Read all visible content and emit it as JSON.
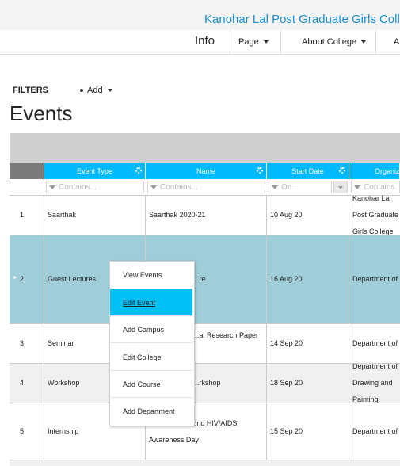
{
  "header": {
    "college_name": "Kanohar Lal Post Graduate Girls College"
  },
  "nav": {
    "info": "Info",
    "items": [
      {
        "label": "Page"
      },
      {
        "label": "About College"
      },
      {
        "label": "A"
      }
    ]
  },
  "toolbar": {
    "filters_label": "FILTERS",
    "add_label": "Add"
  },
  "page": {
    "title": "Events"
  },
  "grid": {
    "columns": [
      {
        "label": ""
      },
      {
        "label": "Event Type"
      },
      {
        "label": "Name"
      },
      {
        "label": "Start Date"
      },
      {
        "label": "Organizer"
      }
    ],
    "filter_placeholders": [
      "Contains...",
      "Contains...",
      "On...",
      "Contains"
    ],
    "rows": [
      {
        "num": "1",
        "type": "Saarthak",
        "name": "Saarthak 2020-21",
        "date": "10 Aug 20",
        "org": "Kanohar Lal Post Graduate Girls College"
      },
      {
        "num": "2",
        "type": "Guest Lectures",
        "name": "...re",
        "date": "16 Aug 20",
        "org": "Department of"
      },
      {
        "num": "3",
        "type": "Seminar",
        "name": "...al Research Paper",
        "date": "14 Sep 20",
        "org": "Department of"
      },
      {
        "num": "4",
        "type": "Workshop",
        "name": "...rkshop",
        "date": "18 Sep 20",
        "org": "Department of Drawing and Painting"
      },
      {
        "num": "5",
        "type": "Internship",
        "name": "Session on World HIV/AIDS Awareness Day",
        "date": "15 Sep 20",
        "org": "Department of"
      }
    ]
  },
  "context_menu": {
    "items": [
      {
        "label": "View Events"
      },
      {
        "label": "Edit Event"
      },
      {
        "label": "Add Campus"
      },
      {
        "label": "Edit College"
      },
      {
        "label": "Add Course"
      },
      {
        "label": "Add Department"
      }
    ]
  },
  "colors": {
    "accent": "#00baff",
    "selected_row": "#9fcdd8",
    "link": "#1a8fd0"
  }
}
